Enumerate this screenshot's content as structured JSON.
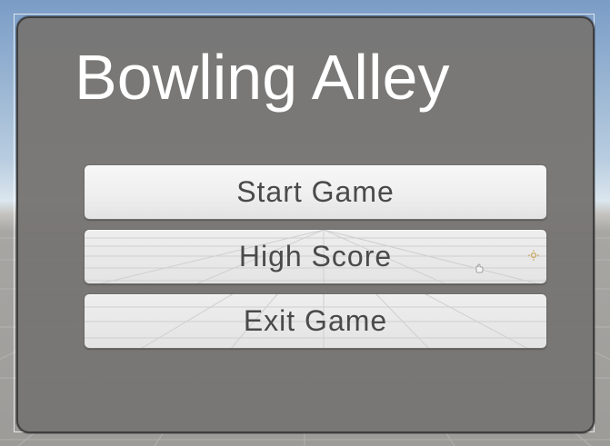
{
  "menu": {
    "title": "Bowling Alley",
    "buttons": {
      "start": "Start Game",
      "high_score": "High Score",
      "exit": "Exit Game"
    }
  },
  "scene_icons": {
    "light": "sun-gizmo-icon",
    "cursor": "hand-cursor-icon"
  },
  "colors": {
    "panel": "#787674",
    "title_text": "#ffffff",
    "button_face": "#f0f0f0",
    "button_text": "#4a4a4a",
    "sky": "#98b4d2",
    "ground": "#9d9b98"
  }
}
